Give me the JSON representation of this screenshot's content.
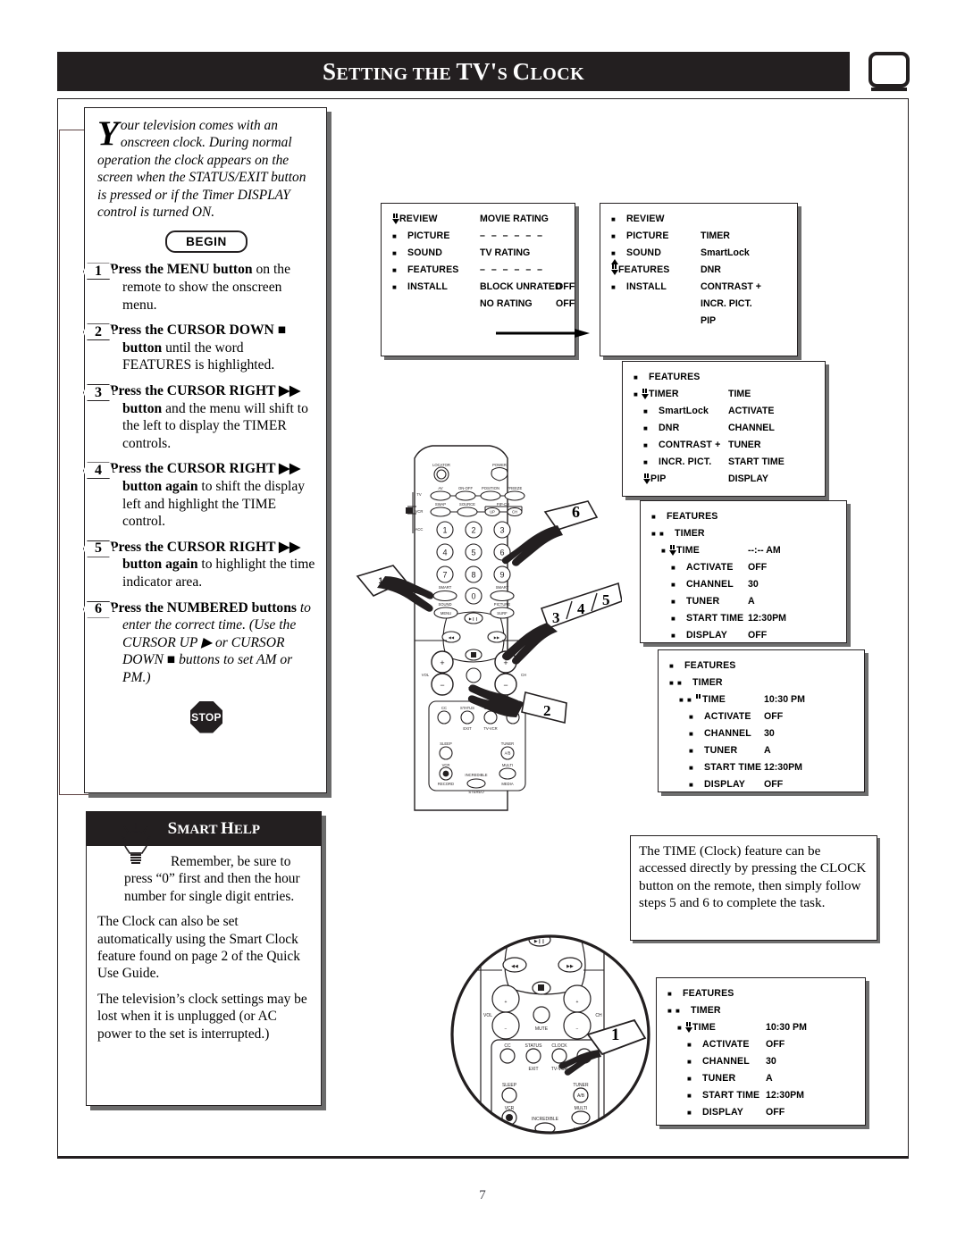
{
  "header": {
    "title_parts": [
      "S",
      "ETTING THE ",
      "TV",
      "'",
      "S ",
      "C",
      "LOCK"
    ],
    "title_plain": "SETTING THE TV'S CLOCK",
    "tv_icon": "tv-icon"
  },
  "page": {
    "number": "7"
  },
  "intro": {
    "dropcap": "Y",
    "text": "our television comes with an onscreen clock. During normal operation the clock appears on the screen when the STATUS/EXIT button is pressed or if the Timer DISPLAY control is turned ON."
  },
  "begin_label": "BEGIN",
  "stop_label": "STOP",
  "steps": [
    {
      "num": "1",
      "lead": "Press the MENU button",
      "rest": " on the remote to show the onscreen menu."
    },
    {
      "num": "2",
      "lead": "Press the CURSOR DOWN ■ button",
      "rest": " until the word FEATURES is highlighted."
    },
    {
      "num": "3",
      "lead": "Press the CURSOR RIGHT ▶▶ button",
      "rest": " and the menu will shift to the left to display the TIMER controls."
    },
    {
      "num": "4",
      "lead": "Press the CURSOR RIGHT ▶▶ button again",
      "rest": " to shift the display left and highlight the TIME control."
    },
    {
      "num": "5",
      "lead": "Press the CURSOR RIGHT ▶▶ button again",
      "rest": " to highlight the time indicator area."
    },
    {
      "num": "6",
      "lead": "Press the NUMBERED buttons",
      "rest": " to enter the correct time. (Use the CURSOR UP ▶ or CURSOR DOWN ■ buttons to set AM or PM.)"
    }
  ],
  "smart_help": {
    "title_s": "S",
    "title_mart": "MART ",
    "title_h": "H",
    "title_elp": "ELP",
    "title_plain": "SMART HELP",
    "paragraphs": [
      "Remember, be sure to press “0” first and then the hour number for single digit entries.",
      "The Clock can also be set automatically using the Smart Clock feature found on page 2 of the Quick Use Guide.",
      "The television’s clock settings may be lost when it is unplugged (or AC power to the set is interrupted.)"
    ],
    "p1_head": "Remember, be sure to",
    "p1_tail": "press “0” first and then the hour number for single digit entries."
  },
  "note": {
    "text": "The TIME (Clock) feature can be accessed directly by pressing the CLOCK button on the remote, then simply follow steps 5 and 6 to complete the task."
  },
  "menus": [
    {
      "id": "menu1",
      "rows": [
        {
          "cursor": "updown",
          "bullet": "",
          "label": "REVIEW",
          "value": "MOVIE RATING",
          "value2": ""
        },
        {
          "cursor": "",
          "bullet": "■",
          "label": "PICTURE",
          "value": "– – – – – –",
          "value2": ""
        },
        {
          "cursor": "",
          "bullet": "■",
          "label": "SOUND",
          "value": "TV RATING",
          "value2": ""
        },
        {
          "cursor": "",
          "bullet": "■",
          "label": "FEATURES",
          "value": "– – – – – –",
          "value2": ""
        },
        {
          "cursor": "",
          "bullet": "■",
          "label": "INSTALL",
          "value": "BLOCK UNRATED",
          "value2": "OFF"
        },
        {
          "cursor": "",
          "bullet": "",
          "label": "",
          "value": "NO RATING",
          "value2": "OFF"
        }
      ]
    },
    {
      "id": "menu2",
      "rows": [
        {
          "cursor": "",
          "bullet": "■",
          "label": "REVIEW",
          "value": "",
          "value2": ""
        },
        {
          "cursor": "",
          "bullet": "■",
          "label": "PICTURE",
          "value": "TIMER",
          "value2": ""
        },
        {
          "cursor": "",
          "bullet": "■",
          "label": "SOUND",
          "value": "SmartLock",
          "value2": ""
        },
        {
          "cursor": "updownboth",
          "bullet": "",
          "label": "FEATURES",
          "value": "DNR",
          "value2": ""
        },
        {
          "cursor": "",
          "bullet": "■",
          "label": "INSTALL",
          "value": "CONTRAST +",
          "value2": ""
        },
        {
          "cursor": "",
          "bullet": "",
          "label": "",
          "value": "INCR. PICT.",
          "value2": ""
        },
        {
          "cursor": "",
          "bullet": "",
          "label": "",
          "value": "PIP",
          "value2": ""
        }
      ]
    },
    {
      "id": "menu3",
      "rows": [
        {
          "indent": 0,
          "cursor": "",
          "bullet": "■",
          "label": "FEATURES",
          "value": "",
          "value2": ""
        },
        {
          "indent": 0,
          "cursor": "updown",
          "bullet": "■",
          "label": "TIMER",
          "value": "TIME",
          "value2": ""
        },
        {
          "indent": 1,
          "cursor": "",
          "bullet": "■",
          "label": "SmartLock",
          "value": "ACTIVATE",
          "value2": ""
        },
        {
          "indent": 1,
          "cursor": "",
          "bullet": "■",
          "label": "DNR",
          "value": "CHANNEL",
          "value2": ""
        },
        {
          "indent": 1,
          "cursor": "",
          "bullet": "■",
          "label": "CONTRAST +",
          "value": "TUNER",
          "value2": ""
        },
        {
          "indent": 1,
          "cursor": "",
          "bullet": "■",
          "label": "INCR. PICT.",
          "value": "START TIME",
          "value2": ""
        },
        {
          "indent": 1,
          "cursor": "down",
          "bullet": "",
          "label": "PIP",
          "value": "DISPLAY",
          "value2": ""
        }
      ]
    },
    {
      "id": "menu4",
      "rows": [
        {
          "indent": 0,
          "cursor": "",
          "bullet": "■",
          "label": "FEATURES",
          "value": "",
          "value2": ""
        },
        {
          "indent": 0,
          "cursor": "",
          "bullet": "■■",
          "label": "TIMER",
          "value": "",
          "value2": ""
        },
        {
          "indent": 1,
          "cursor": "updown",
          "bullet": "■",
          "label": "TIME",
          "value": "--:-- AM",
          "value2": ""
        },
        {
          "indent": 2,
          "cursor": "",
          "bullet": "■",
          "label": "ACTIVATE",
          "value": "OFF",
          "value2": ""
        },
        {
          "indent": 2,
          "cursor": "",
          "bullet": "■",
          "label": "CHANNEL",
          "value": "30",
          "value2": ""
        },
        {
          "indent": 2,
          "cursor": "",
          "bullet": "■",
          "label": "TUNER",
          "value": "A",
          "value2": ""
        },
        {
          "indent": 2,
          "cursor": "",
          "bullet": "■",
          "label": "START TIME",
          "value": "12:30PM",
          "value2": ""
        },
        {
          "indent": 2,
          "cursor": "",
          "bullet": "■",
          "label": "DISPLAY",
          "value": "OFF",
          "value2": ""
        }
      ]
    },
    {
      "id": "menu5",
      "rows": [
        {
          "indent": 0,
          "cursor": "",
          "bullet": "■",
          "label": "FEATURES",
          "value": "",
          "value2": ""
        },
        {
          "indent": 0,
          "cursor": "",
          "bullet": "■■",
          "label": "TIMER",
          "value": "",
          "value2": ""
        },
        {
          "indent": 1,
          "cursor": "pause",
          "bullet": "■■",
          "label": "TIME",
          "value": "10:30 PM",
          "value2": ""
        },
        {
          "indent": 2,
          "cursor": "",
          "bullet": "■",
          "label": "ACTIVATE",
          "value": "OFF",
          "value2": ""
        },
        {
          "indent": 2,
          "cursor": "",
          "bullet": "■",
          "label": "CHANNEL",
          "value": "30",
          "value2": ""
        },
        {
          "indent": 2,
          "cursor": "",
          "bullet": "■",
          "label": "TUNER",
          "value": "A",
          "value2": ""
        },
        {
          "indent": 2,
          "cursor": "",
          "bullet": "■",
          "label": "START TIME",
          "value": "12:30PM",
          "value2": ""
        },
        {
          "indent": 2,
          "cursor": "",
          "bullet": "■",
          "label": "DISPLAY",
          "value": "OFF",
          "value2": ""
        }
      ]
    },
    {
      "id": "menu6",
      "rows": [
        {
          "indent": 0,
          "cursor": "",
          "bullet": "■",
          "label": "FEATURES",
          "value": "",
          "value2": ""
        },
        {
          "indent": 0,
          "cursor": "",
          "bullet": "■■",
          "label": "TIMER",
          "value": "",
          "value2": ""
        },
        {
          "indent": 1,
          "cursor": "updown",
          "bullet": "■",
          "label": "TIME",
          "value": "10:30 PM",
          "value2": ""
        },
        {
          "indent": 2,
          "cursor": "",
          "bullet": "■",
          "label": "ACTIVATE",
          "value": "OFF",
          "value2": ""
        },
        {
          "indent": 2,
          "cursor": "",
          "bullet": "■",
          "label": "CHANNEL",
          "value": "30",
          "value2": ""
        },
        {
          "indent": 2,
          "cursor": "",
          "bullet": "■",
          "label": "TUNER",
          "value": "A",
          "value2": ""
        },
        {
          "indent": 2,
          "cursor": "",
          "bullet": "■",
          "label": "START TIME",
          "value": "12:30PM",
          "value2": ""
        },
        {
          "indent": 2,
          "cursor": "",
          "bullet": "■",
          "label": "DISPLAY",
          "value": "OFF",
          "value2": ""
        }
      ]
    }
  ],
  "remote": {
    "top_labels": {
      "locator": "LOCATOR",
      "power": "POWER"
    },
    "side_labels": [
      "TV",
      "VCR",
      "ACC"
    ],
    "row1": [
      "AV",
      "ON-OFF",
      "POSITION",
      "FREEZE"
    ],
    "row2": [
      "SWAP",
      "SOURCE",
      "UP",
      "CH"
    ],
    "pip_ch_label": "PIP-CH",
    "keypad": [
      "1",
      "2",
      "3",
      "4",
      "5",
      "6",
      "7",
      "8",
      "9",
      "0"
    ],
    "smart_sound": "SMART SOUND",
    "smart_picture": "SMART PICTURE",
    "menu": "MENU",
    "surf": "SURF",
    "vol": "VOL",
    "ch": "CH",
    "mute": "MUTE",
    "bottom_row": [
      "CC",
      "STATUS EXIT",
      "CLOCK TV-VCR"
    ],
    "sleep": "SLEEP",
    "tuner_ab": "TUNER A/B",
    "vcr_record": "VCR RECORD",
    "multi_media": "MULTI MEDIA",
    "incredible_stereo": "INCREDIBLE STEREO"
  },
  "callouts": [
    "1",
    "2",
    "3",
    "4",
    "5",
    "6"
  ],
  "detail_callout": "1",
  "colors": {
    "ink": "#231f20",
    "shadow": "#6e6e6e",
    "paper": "#ffffff"
  }
}
